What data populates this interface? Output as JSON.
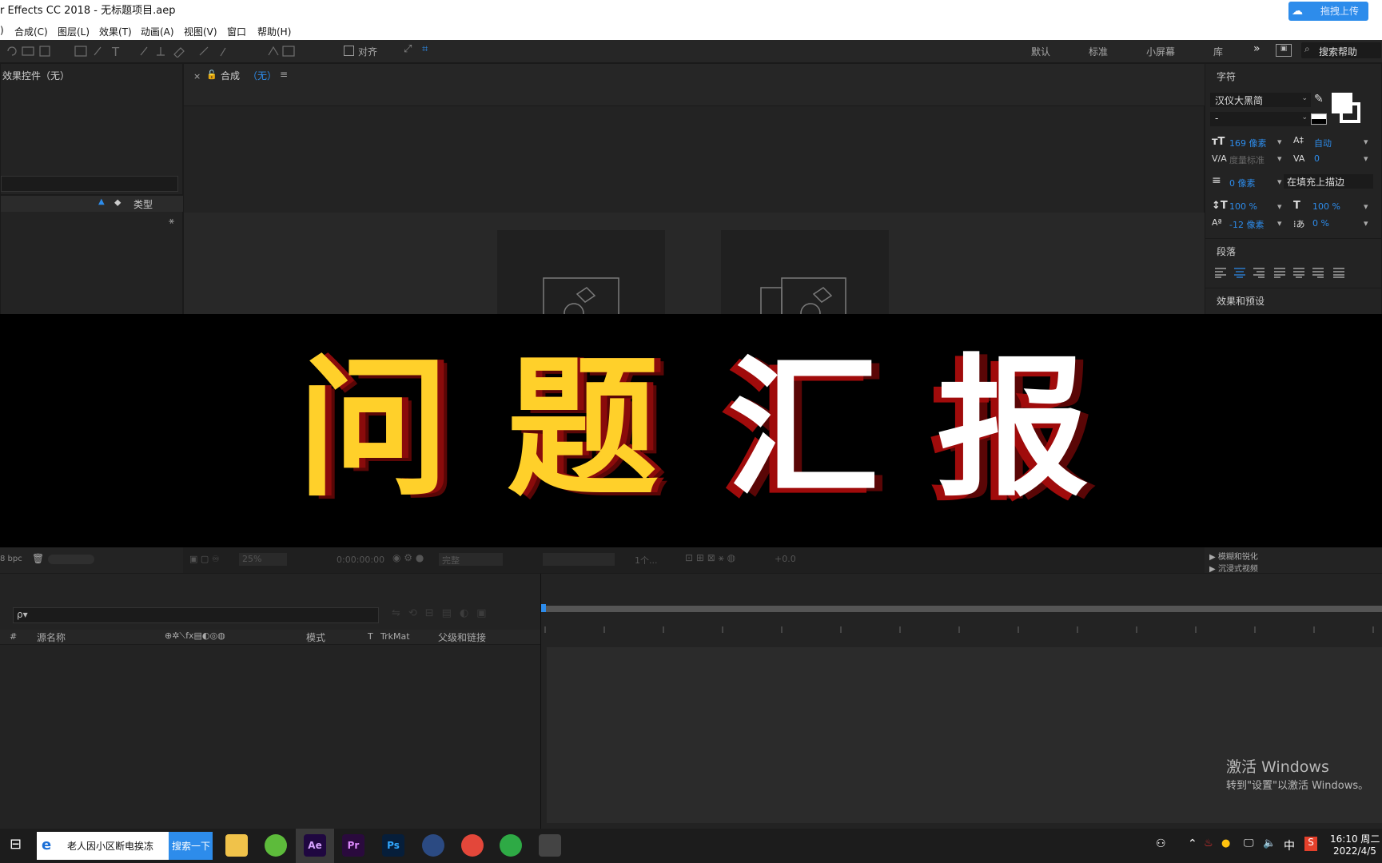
{
  "window": {
    "title": "r Effects CC 2018 - 无标题项目.aep"
  },
  "upload_button": {
    "label": "拖拽上传"
  },
  "menu": [
    "合成(C)",
    "图层(L)",
    "效果(T)",
    "动画(A)",
    "视图(V)",
    "窗口",
    "帮助(H)"
  ],
  "menu_first": ")",
  "toolbar": {
    "align_label": "对齐",
    "workspaces": [
      "默认",
      "标准",
      "小屏幕",
      "库"
    ],
    "search_help": "搜索帮助"
  },
  "effects_panel": {
    "title": "效果控件（无）"
  },
  "project_panel": {
    "type_header": "类型",
    "bpc": "8 bpc"
  },
  "comp_panel": {
    "title": "合成",
    "title_accent": "（无）",
    "zoom": "25%",
    "timecode": "0:00:00:00",
    "quality": "完整",
    "views": "1个...",
    "exposure": "+0.0"
  },
  "character_panel": {
    "title": "字符",
    "font": "汉仪大黑简",
    "font_style": "-",
    "size": "169 像素",
    "leading": "自动",
    "kerning": "度量标准",
    "tracking": "0",
    "stroke_width": "0 像素",
    "stroke_mode": "在填充上描边",
    "vscale": "100 %",
    "hscale": "100 %",
    "baseline": "-12 像素",
    "tsume": "0 %"
  },
  "paragraph_panel": {
    "title": "段落"
  },
  "effects_presets": {
    "title": "效果和预设",
    "items": [
      "模糊和锐化",
      "沉浸式视频"
    ]
  },
  "timeline": {
    "columns": [
      "#",
      "源名称",
      "模式",
      "T",
      "TrkMat",
      "父级和链接"
    ],
    "search_placeholder": "ρ▾"
  },
  "banner": {
    "chars": [
      "问",
      "题",
      "汇",
      "报"
    ]
  },
  "watermark": {
    "line1": "激活 Windows",
    "line2": "转到\"设置\"以激活 Windows。"
  },
  "taskbar": {
    "search_text": "老人因小区断电挨冻",
    "search_button": "搜索一下",
    "apps": [
      "Ae",
      "Pr",
      "Ps"
    ],
    "ime": "中",
    "time": "16:10 周二",
    "date": "2022/4/5"
  },
  "colors": {
    "accent_blue": "#2d8ceb",
    "banner_yellow": "#ffd02a",
    "banner_red": "#8a0b0b"
  }
}
